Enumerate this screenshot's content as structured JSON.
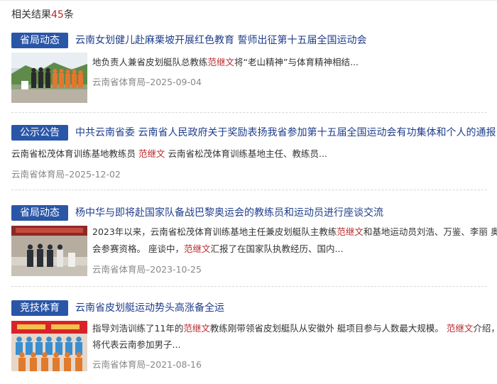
{
  "summary": {
    "prefix": "相关结果",
    "count": "45",
    "suffix": "条"
  },
  "results": [
    {
      "tag": "省局动态",
      "title": "云南女划健儿赴麻栗坡开展红色教育 誓师出征第十五届全国运动会",
      "lines": [
        [
          {
            "t": "地负责人兼省皮划艇队总教练"
          },
          {
            "t": "范继文",
            "hl": true
          },
          {
            "t": "将“老山精神”与体育精神相结..."
          }
        ]
      ],
      "meta": "云南省体育局–2025-09-04"
    },
    {
      "tag": "公示公告",
      "title": "中共云南省委 云南省人民政府关于奖励表扬我省参加第十五届全国运动会有功集体和个人的通报",
      "lines": [
        [
          {
            "t": "云南省松茂体育训练基地教练员 "
          },
          {
            "t": "范继文",
            "hl": true
          },
          {
            "t": " 云南省松茂体育训练基地主任、教练员..."
          }
        ]
      ],
      "meta": "云南省体育局–2025-12-02"
    },
    {
      "tag": "省局动态",
      "title": "杨中华与即将赴国家队备战巴黎奥运会的教练员和运动员进行座谈交流",
      "lines": [
        [
          {
            "t": "2023年以来，云南省松茂体育训练基地主任兼皮划艇队主教练"
          },
          {
            "t": "范继文",
            "hl": true
          },
          {
            "t": "和基地运动员刘浩、万鉴、李丽 奥运"
          }
        ],
        [
          {
            "t": "会参赛资格。 座谈中，"
          },
          {
            "t": "范继文",
            "hl": true
          },
          {
            "t": "汇报了在国家队执教经历、国内..."
          }
        ]
      ],
      "meta": "云南省体育局–2023-10-25"
    },
    {
      "tag": "竞技体育",
      "title": "云南省皮划艇运动势头高涨备全运",
      "lines": [
        [
          {
            "t": "指导刘浩训练了11年的"
          },
          {
            "t": "范继文",
            "hl": true
          },
          {
            "t": "教练刚带领省皮划艇队从安徽外 艇项目参与人数最大规模。 "
          },
          {
            "t": "范继文",
            "hl": true
          },
          {
            "t": "介绍，刘浩"
          }
        ],
        [
          {
            "t": "将代表云南参加男子..."
          }
        ]
      ],
      "meta": "云南省体育局–2021-08-16"
    }
  ]
}
